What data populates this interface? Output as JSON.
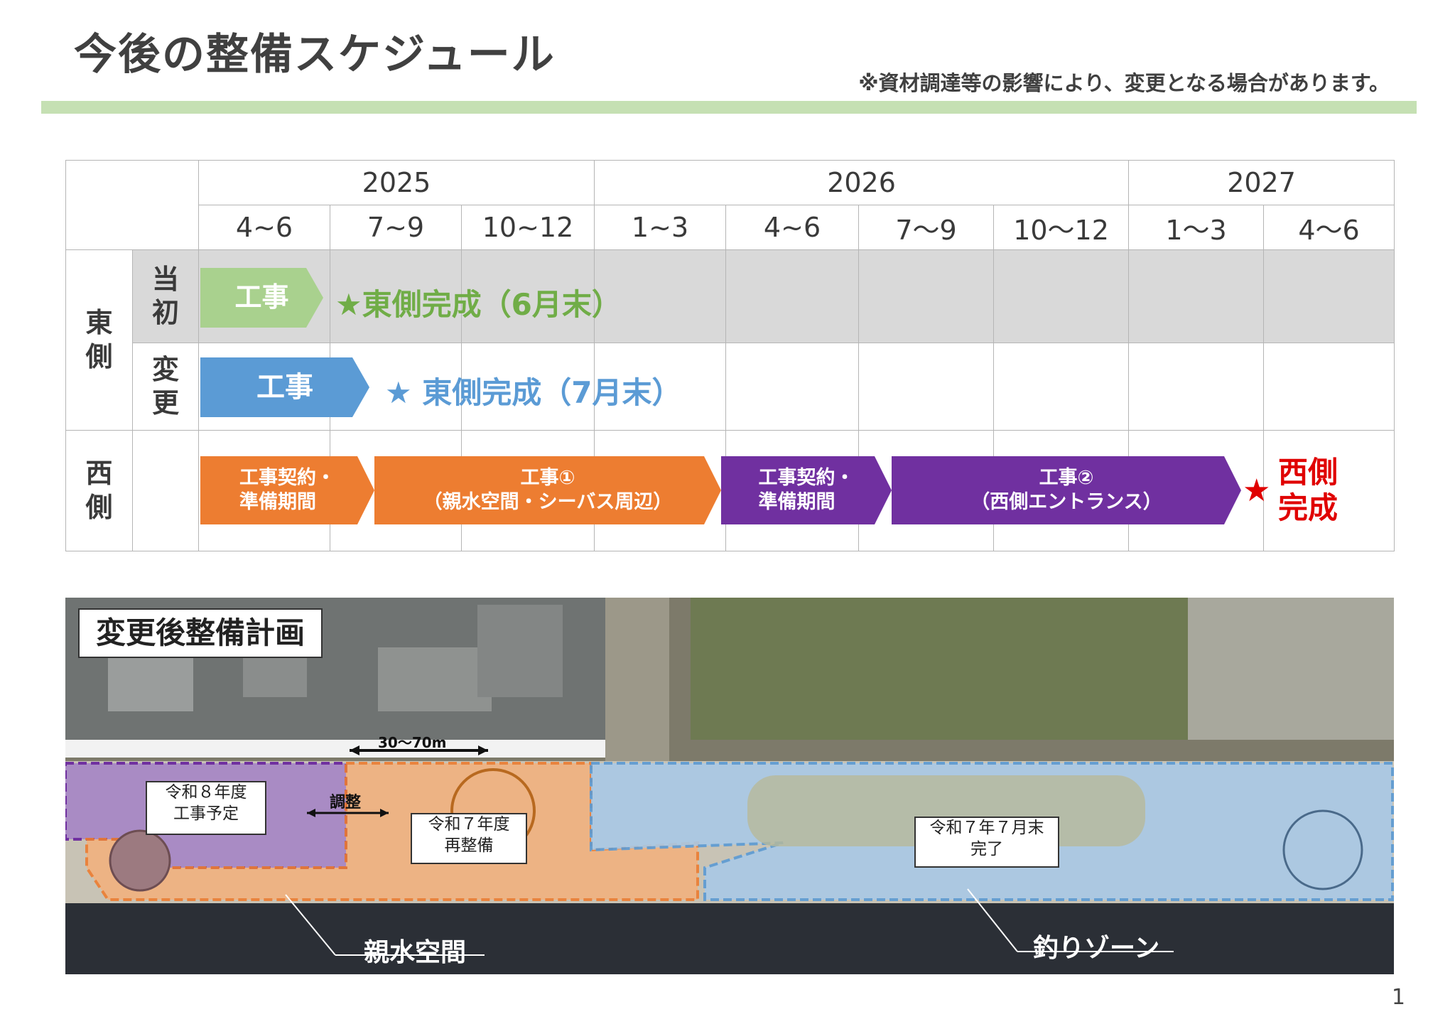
{
  "title": "今後の整備スケジュール",
  "note": "※資材調達等の影響により、変更となる場合があります。",
  "table": {
    "years": [
      "2025",
      "2026",
      "2027"
    ],
    "quarters": [
      "4~6",
      "7~9",
      "10~12",
      "1~3",
      "4~6",
      "7～9",
      "10～12",
      "1～3",
      "4～6"
    ],
    "east_label": "東側",
    "west_label": "西側",
    "row_initial": "当初",
    "row_changed": "変更"
  },
  "bars": {
    "initial_work": "工事",
    "initial_milestone": "★東側完成（6月末）",
    "changed_work": "工事",
    "changed_milestone": "★ 東側完成（7月末）",
    "west_prep1": "工事契約・\n準備期間",
    "west_work1": "工事①\n（親水空間・シーバス周辺）",
    "west_prep2": "工事契約・\n準備期間",
    "west_work2": "工事②\n（西側エントランス）",
    "west_milestone_star": "★",
    "west_milestone": "西側\n完成"
  },
  "colors": {
    "green": "#a9d18e",
    "blue": "#5b9bd5",
    "orange": "#ed7d31",
    "purple": "#7030a0",
    "red": "#e00000"
  },
  "map": {
    "title": "変更後整備計画",
    "distance": "30～70m",
    "adjust": "調整",
    "zone_r8": "令和８年度\n工事予定",
    "zone_r7": "令和７年度\n再整備",
    "zone_done": "令和７年７月末\n完了",
    "area_water": "親水空間",
    "area_fishing": "釣りゾーン"
  },
  "page_number": "1"
}
